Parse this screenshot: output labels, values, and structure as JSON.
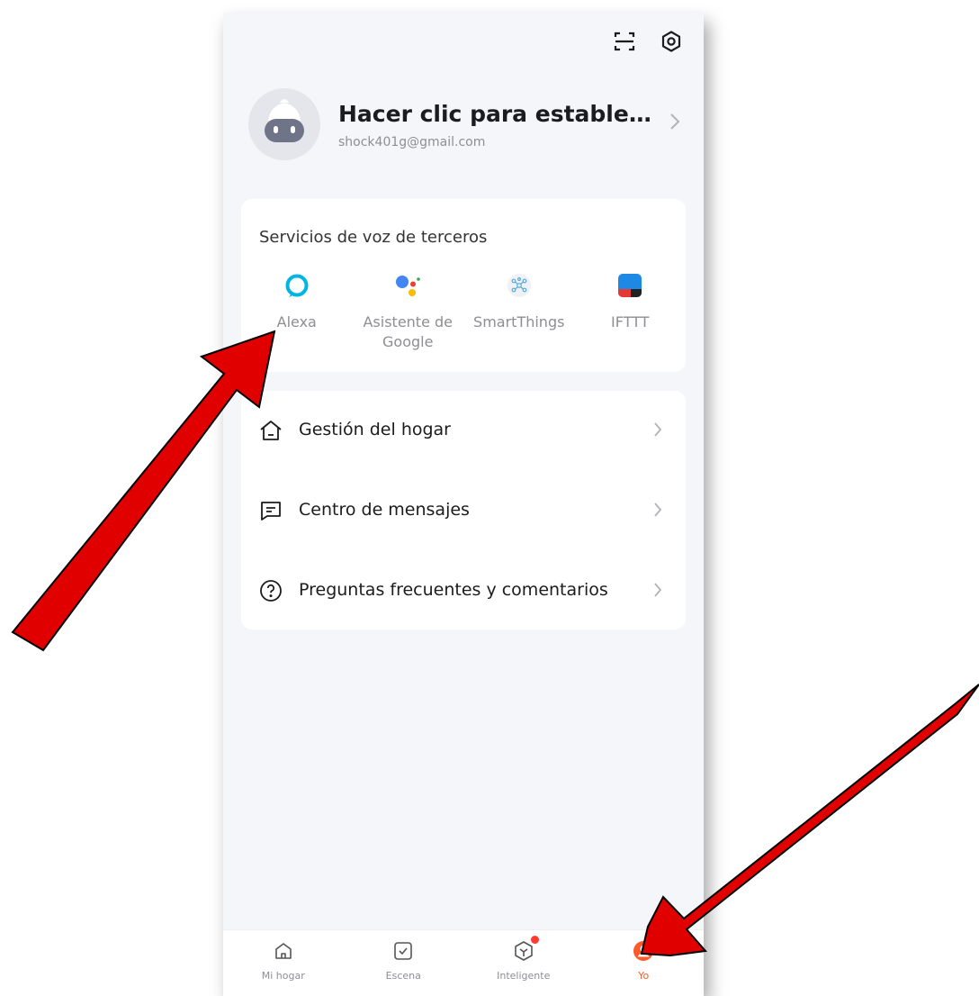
{
  "header": {
    "icons": [
      "scan-icon",
      "settings-icon"
    ]
  },
  "profile": {
    "name": "Hacer clic para establecer u...",
    "email": "shock401g@gmail.com"
  },
  "voice_services": {
    "title": "Servicios de voz de terceros",
    "items": [
      {
        "label": "Alexa",
        "icon": "alexa-icon",
        "color": "#00b5e2"
      },
      {
        "label": "Asistente de Google",
        "icon": "google-assistant-icon",
        "color": "#4285f4"
      },
      {
        "label": "SmartThings",
        "icon": "smartthings-icon",
        "color": "#5aa9d8"
      },
      {
        "label": "IFTTT",
        "icon": "ifttt-icon",
        "color": "#1e88e5"
      }
    ]
  },
  "menu": {
    "items": [
      {
        "label": "Gestión del hogar",
        "icon": "home-icon"
      },
      {
        "label": "Centro de mensajes",
        "icon": "message-icon"
      },
      {
        "label": "Preguntas frecuentes y comentarios",
        "icon": "help-icon"
      }
    ]
  },
  "tabbar": {
    "items": [
      {
        "label": "Mi hogar",
        "icon": "home-icon"
      },
      {
        "label": "Escena",
        "icon": "checkbox-icon"
      },
      {
        "label": "Inteligente",
        "icon": "smart-icon"
      },
      {
        "label": "Yo",
        "icon": "user-icon",
        "active": true
      }
    ]
  },
  "colors": {
    "accent": "#ff5a29",
    "arrow": "#e00000",
    "background": "#f5f6f9"
  }
}
